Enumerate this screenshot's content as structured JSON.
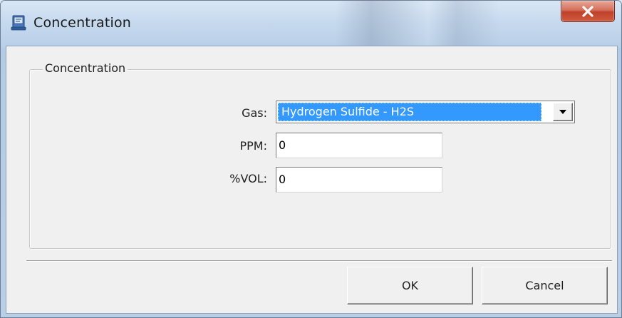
{
  "window": {
    "title": "Concentration",
    "app_icon": "app-window-icon",
    "close_icon": "close-icon"
  },
  "group": {
    "label": "Concentration"
  },
  "fields": {
    "gas_label": "Gas:",
    "gas_value": "Hydrogen Sulfide - H2S",
    "ppm_label": "PPM:",
    "ppm_value": "0",
    "vol_label": "%VOL:",
    "vol_value": "0"
  },
  "buttons": {
    "ok": "OK",
    "cancel": "Cancel"
  },
  "colors": {
    "selection": "#3399ff",
    "close_button": "#c8432b",
    "dialog_background": "#f0f0f0"
  }
}
